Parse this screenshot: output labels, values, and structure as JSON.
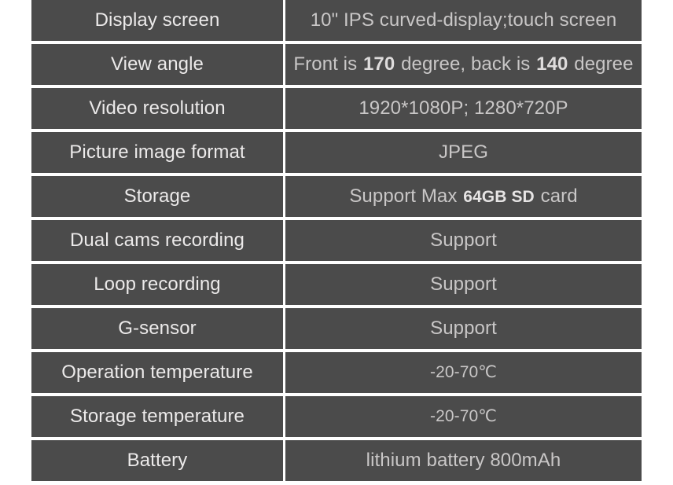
{
  "table": {
    "rows": [
      {
        "label": "Display screen",
        "value": "10\" IPS curved-display;touch screen",
        "value_size": "normal"
      },
      {
        "label": "View angle",
        "value": "Front is 170 degree, back is 140 degree",
        "value_parts": [
          {
            "text": "Front is ",
            "style": "normal"
          },
          {
            "text": "170",
            "style": "emph-num"
          },
          {
            "text": " degree, back is ",
            "style": "normal"
          },
          {
            "text": "140",
            "style": "emph-num"
          },
          {
            "text": " degree",
            "style": "normal"
          }
        ],
        "value_size": "normal"
      },
      {
        "label": "Video resolution",
        "value": "1920*1080P; 1280*720P",
        "value_size": "normal"
      },
      {
        "label": "Picture image format",
        "value": "JPEG",
        "value_size": "normal"
      },
      {
        "label": "Storage",
        "value": "Support Max 64GB SD card",
        "value_parts": [
          {
            "text": "Support Max ",
            "style": "normal"
          },
          {
            "text": "64GB SD",
            "style": "emph"
          },
          {
            "text": " card",
            "style": "normal"
          }
        ],
        "value_size": "normal"
      },
      {
        "label": "Dual cams recording",
        "value": "Support",
        "value_size": "normal"
      },
      {
        "label": "Loop recording",
        "value": "Support",
        "value_size": "normal"
      },
      {
        "label": "G-sensor",
        "value": "Support",
        "value_size": "normal"
      },
      {
        "label": "Operation temperature",
        "value": "-20-70℃",
        "value_size": "small"
      },
      {
        "label": "Storage temperature",
        "value": "-20-70℃",
        "value_size": "small"
      },
      {
        "label": "Battery",
        "value": "lithium battery 800mAh",
        "value_size": "normal"
      }
    ]
  },
  "colors": {
    "page_background": "#ffffff",
    "cell_background": "#4b4b4b",
    "label_text": "#eceaea",
    "value_text": "#c9c7c7",
    "emphasis_text": "#e6e4e4"
  }
}
